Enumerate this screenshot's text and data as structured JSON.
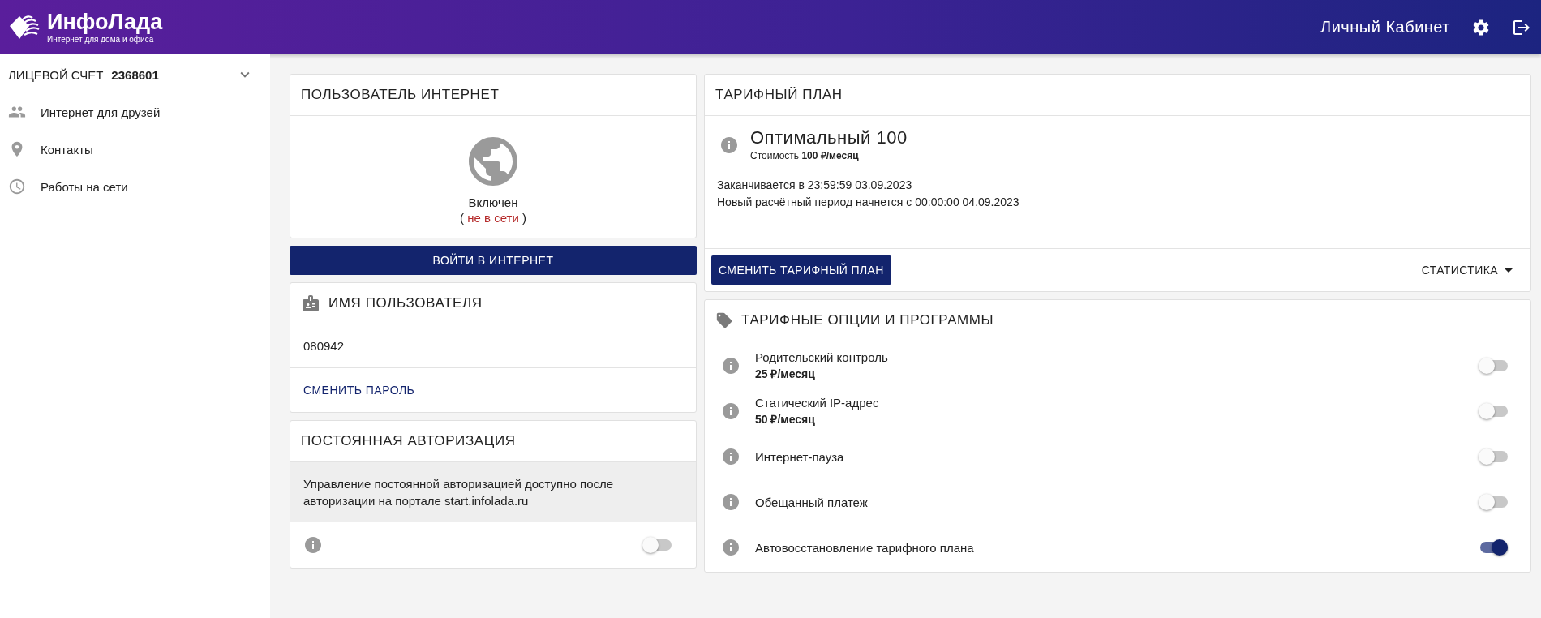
{
  "header": {
    "logo_name": "ИнфоЛада",
    "logo_tagline": "Интернет для дома и офиса",
    "cabinet_title": "Личный Кабинет"
  },
  "sidebar": {
    "account_label": "ЛИЦЕВОЙ СЧЕТ",
    "account_number": "2368601",
    "expanded": false,
    "items": [
      {
        "kind": "friends",
        "label": "Интернет для друзей"
      },
      {
        "kind": "contacts",
        "label": "Контакты"
      },
      {
        "kind": "works",
        "label": "Работы на сети"
      }
    ]
  },
  "internet_user": {
    "title": "ПОЛЬЗОВАТЕЛЬ ИНТЕРНЕТ",
    "status": "Включен",
    "note_open": "(",
    "note": "не в сети",
    "note_close": ")",
    "online": false,
    "login_button": "ВОЙТИ В ИНТЕРНЕТ"
  },
  "username": {
    "title": "ИМЯ ПОЛЬЗОВАТЕЛЯ",
    "value": "080942",
    "change_password": "СМЕНИТЬ ПАРОЛЬ"
  },
  "persistent_auth": {
    "title": "ПОСТОЯННАЯ АВТОРИЗАЦИЯ",
    "notice": "Управление постоянной авторизацией доступно после авторизации на портале start.infolada.ru",
    "checked": false
  },
  "tariff": {
    "title": "ТАРИФНЫЙ ПЛАН",
    "plan_name": "Оптимальный 100",
    "cost": "Стоимость **100 ₽/месяц**",
    "ends": "Заканчивается в 23:59:59 03.09.2023",
    "next_period": "Новый расчётный период начнется с 00:00:00 04.09.2023",
    "change_button": "СМЕНИТЬ ТАРИФНЫЙ ПЛАН",
    "stats": "СТАТИСТИКА"
  },
  "options": {
    "title": "ТАРИФНЫЕ ОПЦИИ И ПРОГРАММЫ",
    "items": [
      {
        "name": "Родительский контроль",
        "price": "25 ₽/месяц",
        "checked": false
      },
      {
        "name": "Статический IP-адрес",
        "price": "50 ₽/месяц",
        "checked": false
      },
      {
        "name": "Интернет-пауза",
        "checked": false
      },
      {
        "name": "Обещанный платеж",
        "checked": false
      },
      {
        "name": "Автовосстановление тарифного плана",
        "checked": true
      }
    ]
  }
}
